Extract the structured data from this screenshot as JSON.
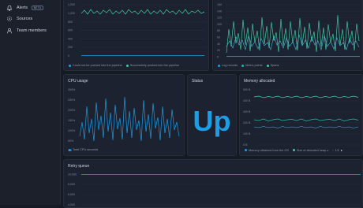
{
  "colors": {
    "blue": "#1a9ee8",
    "teal": "#23b5a5",
    "cyan": "#3fb7d9",
    "green": "#40c9a2"
  },
  "sidebar": {
    "items": [
      {
        "label": "Alerts",
        "badge": "BETA",
        "icon": "bell-icon"
      },
      {
        "label": "Sources",
        "icon": "sources-icon"
      },
      {
        "label": "Team members",
        "icon": "user-icon"
      }
    ]
  },
  "panels": {
    "pipeline": {
      "yticks": [
        "1,200",
        "1,000",
        "800",
        "600",
        "400",
        "200",
        "0"
      ],
      "legend": [
        "Could not be pushed into the pipeline",
        "Successfully pushed into the pipeline"
      ]
    },
    "records": {
      "yticks": [
        "160",
        "140",
        "120",
        "100",
        "80",
        "60",
        "40",
        "20",
        "0"
      ],
      "legend": [
        "Log records",
        "Metric points",
        "Spans"
      ]
    },
    "cpu": {
      "title": "CPU usage",
      "yticks": [
        "300%",
        "250%",
        "200%",
        "150%",
        "100%",
        "50%",
        "0%"
      ],
      "legend": [
        "Total CPU seconds"
      ]
    },
    "status": {
      "title": "Status",
      "value": "Up"
    },
    "memory": {
      "title": "Memory allocated",
      "yticks": [
        "500 B",
        "400 B",
        "300 B",
        "200 B",
        "100 B",
        "0 B"
      ],
      "legend": [
        "Memory obtained from the OS",
        "Size of allocated heap o"
      ],
      "pager": "1/2"
    },
    "retry": {
      "title": "Retry queue",
      "yticks": [
        "10,000",
        "8,000",
        "6,000",
        "4,000"
      ]
    }
  }
}
